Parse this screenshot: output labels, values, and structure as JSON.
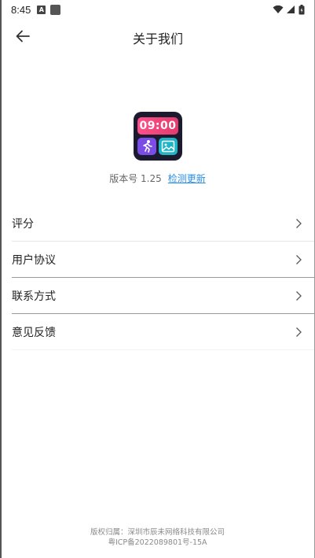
{
  "status_bar": {
    "time": "8:45",
    "a_badge": "A"
  },
  "header": {
    "title": "关于我们"
  },
  "app": {
    "icon_time": "09:00",
    "version": "版本号 1.25",
    "check_update": "检测更新"
  },
  "menu": [
    {
      "label": "评分"
    },
    {
      "label": "用户协议"
    },
    {
      "label": "联系方式"
    },
    {
      "label": "意见反馈"
    }
  ],
  "footer": {
    "copyright": "版权归属：深圳市辰未网络科技有限公司",
    "icp": "粤ICP备2022089801号-15A"
  }
}
